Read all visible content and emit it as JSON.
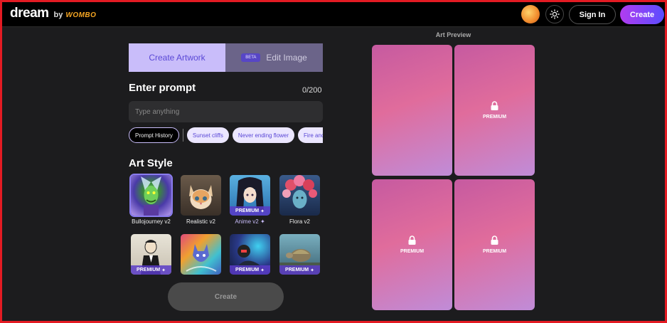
{
  "header": {
    "logo_main": "dream",
    "logo_by": "by",
    "logo_brand": "WOMBO",
    "signin_label": "Sign In",
    "create_label": "Create"
  },
  "tabs": {
    "create_label": "Create Artwork",
    "beta_label": "BETA",
    "edit_label": "Edit Image"
  },
  "prompt": {
    "heading": "Enter prompt",
    "count": "0/200",
    "placeholder": "Type anything",
    "history_label": "Prompt History",
    "suggestions": [
      "Sunset cliffs",
      "Never ending flower",
      "Fire and water"
    ]
  },
  "art_style": {
    "heading": "Art Style",
    "premium_label": "PREMIUM",
    "items": [
      {
        "label": "Bullojourney v2",
        "premium": false
      },
      {
        "label": "Realistic v2",
        "premium": false
      },
      {
        "label": "Anime v2",
        "premium": true
      },
      {
        "label": "Flora v2",
        "premium": false
      },
      {
        "label": "",
        "premium": true
      },
      {
        "label": "",
        "premium": false
      },
      {
        "label": "",
        "premium": true
      },
      {
        "label": "",
        "premium": true
      }
    ]
  },
  "create_button": "Create",
  "preview": {
    "title": "Art Preview",
    "premium_label": "PREMIUM"
  },
  "colors": {
    "accent": "#5a48d6",
    "tab_active_bg": "#c9bdfa",
    "create_gradient_start": "#b23cf0",
    "create_gradient_end": "#5a4dff",
    "frame_border": "#e31b23"
  }
}
